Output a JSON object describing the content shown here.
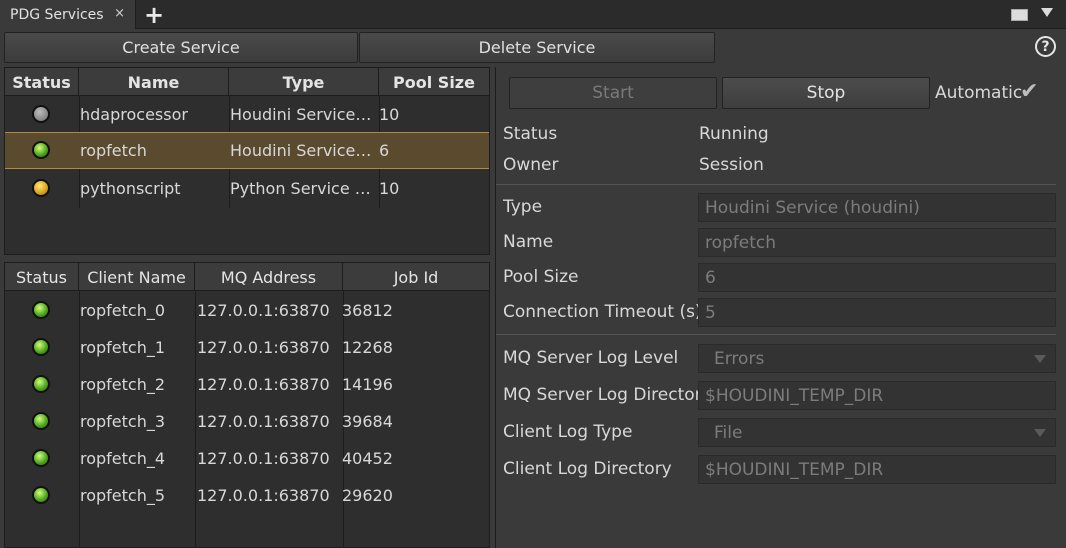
{
  "tab": {
    "title": "PDG Services",
    "close": "×",
    "add": "+"
  },
  "toolbar": {
    "create_label": "Create Service",
    "delete_label": "Delete Service",
    "help": "?"
  },
  "services_table": {
    "headers": [
      "Status",
      "Name",
      "Type",
      "Pool Size"
    ],
    "rows": [
      {
        "status": "gray",
        "name": "hdaprocessor",
        "type": "Houdini Service…",
        "pool": "10"
      },
      {
        "status": "green",
        "name": "ropfetch",
        "type": "Houdini Service…",
        "pool": "6"
      },
      {
        "status": "yellow",
        "name": "pythonscript",
        "type": "Python Service …",
        "pool": "10"
      }
    ]
  },
  "clients_table": {
    "headers": [
      "Status",
      "Client Name",
      "MQ Address",
      "Job Id"
    ],
    "rows": [
      {
        "status": "green",
        "name": "ropfetch_0",
        "address": "127.0.0.1:63870",
        "job": "36812"
      },
      {
        "status": "green",
        "name": "ropfetch_1",
        "address": "127.0.0.1:63870",
        "job": "12268"
      },
      {
        "status": "green",
        "name": "ropfetch_2",
        "address": "127.0.0.1:63870",
        "job": "14196"
      },
      {
        "status": "green",
        "name": "ropfetch_3",
        "address": "127.0.0.1:63870",
        "job": "39684"
      },
      {
        "status": "green",
        "name": "ropfetch_4",
        "address": "127.0.0.1:63870",
        "job": "40452"
      },
      {
        "status": "green",
        "name": "ropfetch_5",
        "address": "127.0.0.1:63870",
        "job": "29620"
      }
    ]
  },
  "details": {
    "start_label": "Start",
    "stop_label": "Stop",
    "automatic_label": "Automatic",
    "automatic_checked": "✔",
    "status_label": "Status",
    "status_value": "Running",
    "owner_label": "Owner",
    "owner_value": "Session",
    "type_label": "Type",
    "type_value": "Houdini Service (houdini)",
    "name_label": "Name",
    "name_value": "ropfetch",
    "pool_label": "Pool Size",
    "pool_value": "6",
    "timeout_label": "Connection Timeout (s)",
    "timeout_value": "5",
    "mq_level_label": "MQ Server Log Level",
    "mq_level_value": "Errors",
    "mq_dir_label": "MQ Server Log Directory",
    "mq_dir_value": "$HOUDINI_TEMP_DIR",
    "client_type_label": "Client Log Type",
    "client_type_value": "File",
    "client_dir_label": "Client Log Directory",
    "client_dir_value": "$HOUDINI_TEMP_DIR"
  },
  "colors": {
    "selection": "#5a4a2e",
    "status_green": "#4aa01a",
    "status_yellow": "#d7a11a",
    "status_gray": "#8a8a8a"
  }
}
